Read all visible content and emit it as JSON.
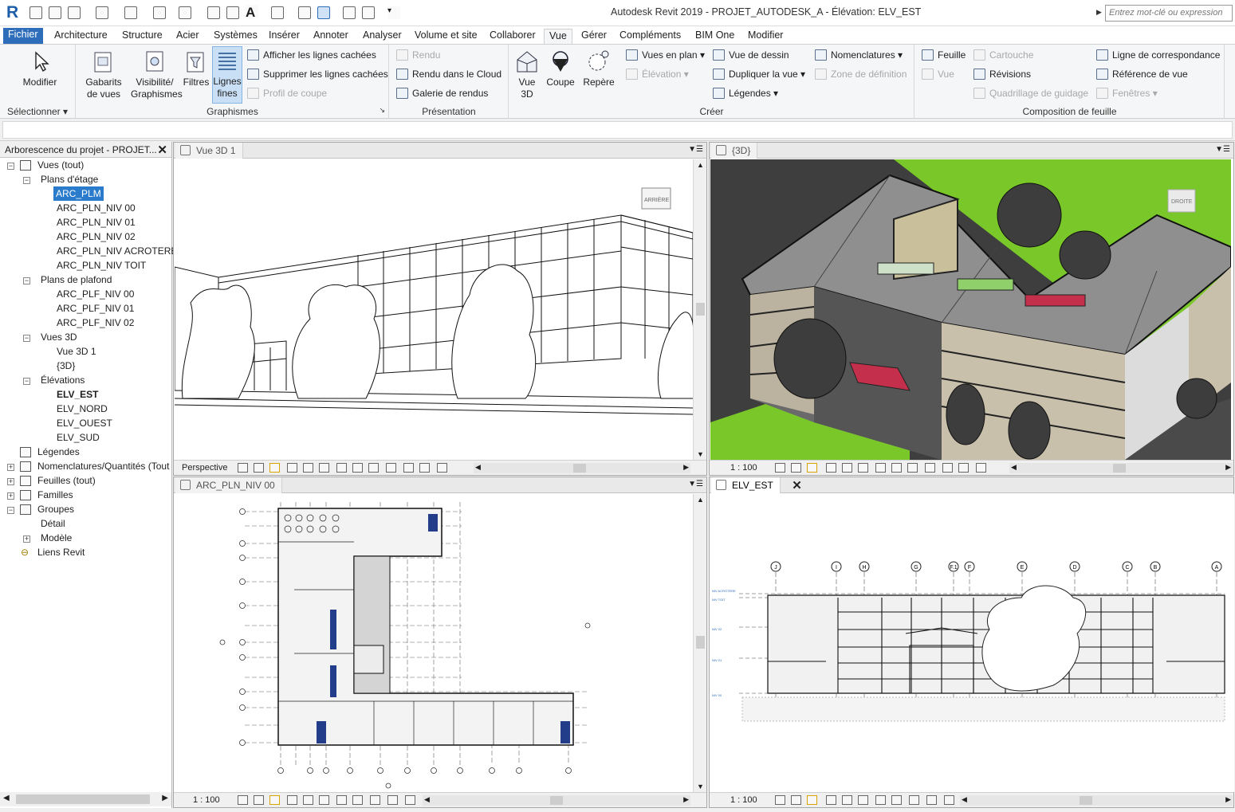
{
  "app": {
    "logo": "R",
    "title": "Autodesk Revit 2019 - PROJET_AUTODESK_A - Élévation: ELV_EST",
    "search_placeholder": "Entrez mot-clé ou expression"
  },
  "tabs": [
    "Fichier",
    "Architecture",
    "Structure",
    "Acier",
    "Systèmes",
    "Insérer",
    "Annoter",
    "Analyser",
    "Volume et site",
    "Collaborer",
    "Vue",
    "Gérer",
    "Compléments",
    "BIM One",
    "Modifier"
  ],
  "ribbon": {
    "select": {
      "button": "Modifier",
      "title": "Sélectionner"
    },
    "graphismes": {
      "title": "Graphismes",
      "buttons": [
        "Gabarits\nde vues",
        "Visibilité/\nGraphismes",
        "Filtres",
        "Lignes\nfines"
      ],
      "small": [
        "Afficher les lignes cachées",
        "Supprimer les lignes cachées",
        "Profil de coupe"
      ]
    },
    "presentation": {
      "title": "Présentation",
      "small": [
        "Rendu",
        "Rendu  dans le Cloud",
        "Galerie  de rendus"
      ]
    },
    "creer": {
      "title": "Créer",
      "buttons": [
        "Vue\n3D",
        "Coupe",
        "Repère"
      ],
      "small": [
        "Vues en plan",
        "Élévation",
        "Vue de dessin",
        "Dupliquer la vue",
        "Légendes",
        "Nomenclatures",
        "Zone de définition"
      ]
    },
    "feuille": {
      "title": "Composition de feuille",
      "small": [
        "Feuille",
        "Vue",
        "Cartouche",
        "Révisions",
        "Quadrillage de guidage",
        "Ligne de correspondance",
        "Référence de vue",
        "Fenêtres"
      ]
    }
  },
  "browser": {
    "title": "Arborescence du projet - PROJET...",
    "items": [
      {
        "label": "Vues (tout)"
      },
      {
        "label": "Plans d'étage"
      },
      {
        "label": "ARC_PLM"
      },
      {
        "label": "ARC_PLN_NIV 00"
      },
      {
        "label": "ARC_PLN_NIV 01"
      },
      {
        "label": "ARC_PLN_NIV 02"
      },
      {
        "label": "ARC_PLN_NIV ACROTERE"
      },
      {
        "label": "ARC_PLN_NIV TOIT"
      },
      {
        "label": "Plans de plafond"
      },
      {
        "label": "ARC_PLF_NIV 00"
      },
      {
        "label": "ARC_PLF_NIV 01"
      },
      {
        "label": "ARC_PLF_NIV 02"
      },
      {
        "label": "Vues 3D"
      },
      {
        "label": "Vue 3D 1"
      },
      {
        "label": "{3D}"
      },
      {
        "label": "Élévations"
      },
      {
        "label": "ELV_EST"
      },
      {
        "label": "ELV_NORD"
      },
      {
        "label": "ELV_OUEST"
      },
      {
        "label": "ELV_SUD"
      },
      {
        "label": "Légendes"
      },
      {
        "label": "Nomenclatures/Quantités (Tout"
      },
      {
        "label": "Feuilles (tout)"
      },
      {
        "label": "Familles"
      },
      {
        "label": "Groupes"
      },
      {
        "label": "Détail"
      },
      {
        "label": "Modèle"
      },
      {
        "label": "Liens Revit"
      }
    ]
  },
  "views": {
    "v3d1": {
      "tab": "Vue 3D 1",
      "scale": "Perspective",
      "cube": "ARRIÈRE"
    },
    "v3d": {
      "tab": "{3D}",
      "scale": "1 : 100",
      "cube": "DROITE"
    },
    "plan": {
      "tab": "ARC_PLN_NIV 00",
      "scale": "1 : 100"
    },
    "elev": {
      "tab": "ELV_EST",
      "scale": "1 : 100",
      "grids": [
        "J",
        "I",
        "H",
        "G",
        "F.1",
        "F",
        "E",
        "D",
        "C",
        "B",
        "A"
      ],
      "levels": [
        "NIV ACROTERE",
        "NIV TOIT",
        "NIV 02",
        "NIV 01",
        "NIV 00"
      ]
    }
  },
  "colors": {
    "accent": "#2d6dba",
    "grass": "#7ac72a",
    "roof": "#8f8f8f",
    "canopy": "#c4304c"
  }
}
